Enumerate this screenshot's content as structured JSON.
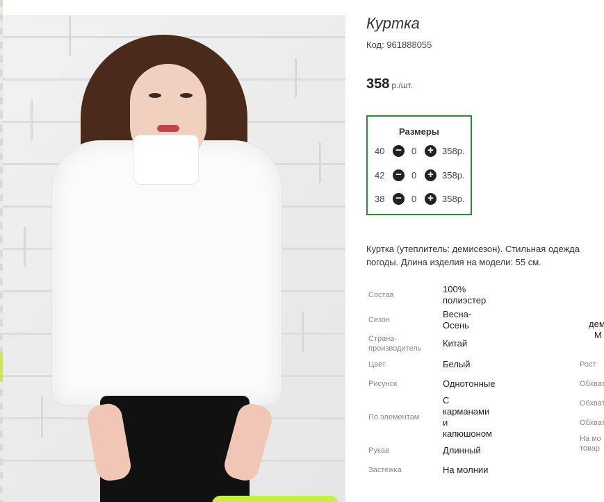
{
  "product": {
    "title": "Куртка",
    "code": "Код: 961888055",
    "price": "358",
    "price_unit": "р./шт."
  },
  "sizes": {
    "title": "Размеры",
    "minus_icon": "minus-circle-icon",
    "plus_icon": "plus-circle-icon",
    "rows": [
      {
        "size": "40",
        "qty": "0",
        "price": "358р."
      },
      {
        "size": "42",
        "qty": "0",
        "price": "358р."
      },
      {
        "size": "38",
        "qty": "0",
        "price": "358р."
      }
    ]
  },
  "description": {
    "line1": "Куртка (утеплитель: демисезон). Стильная одежда",
    "line2": "погоды. Длина изделия на модели: 55 см."
  },
  "specs": [
    {
      "label": "Состав",
      "value_lines": [
        "100%",
        "полиэстер"
      ]
    },
    {
      "label": "Сезон",
      "value_lines": [
        "Весна-",
        "Осень"
      ]
    },
    {
      "label_lines": [
        "Страна-",
        "производитель"
      ],
      "value": "Китай"
    },
    {
      "label": "Цвет",
      "value": "Белый"
    },
    {
      "label": "Рисунок",
      "value": "Однотонные"
    },
    {
      "label": "По элементам",
      "value_lines": [
        "С",
        "карманами",
        "и",
        "капюшоном"
      ]
    },
    {
      "label": "Рукав",
      "value": "Длинный"
    },
    {
      "label": "Застежка",
      "value": "На молнии"
    }
  ],
  "specs_right": {
    "partial_value_1": "дем",
    "partial_value_2": "М",
    "partial_labels": [
      "Рост",
      "Обхват",
      "Обхват",
      "Обхват"
    ],
    "partial_note_lines": [
      "На мо",
      "товар"
    ]
  },
  "colors": {
    "sizes_border": "#2e8b2e",
    "accent_green": "#c6ef3e"
  }
}
